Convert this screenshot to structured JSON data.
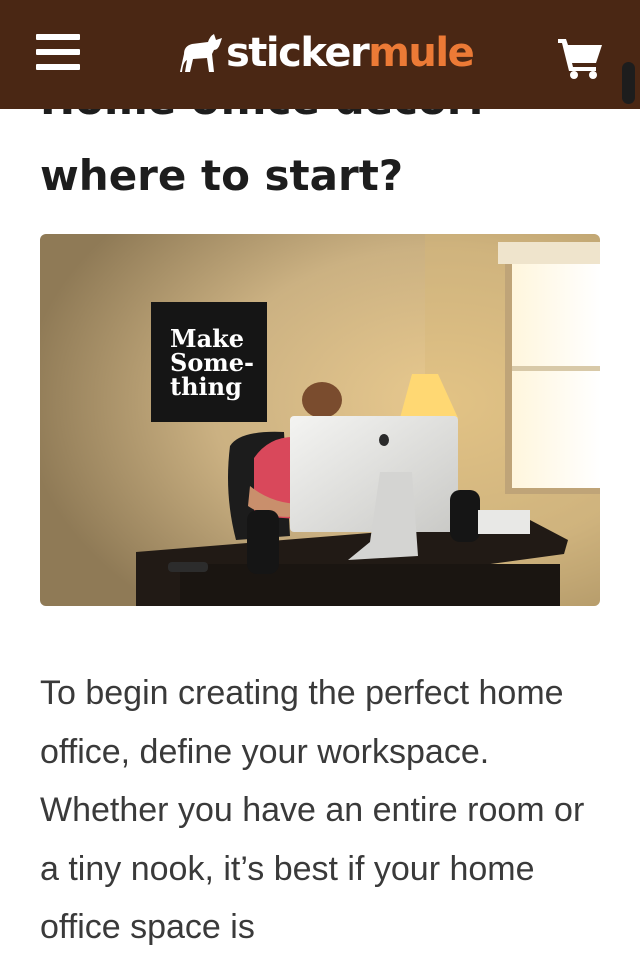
{
  "header": {
    "brand_part1": "sticker",
    "brand_part2": "mule",
    "menu_icon": "hamburger-menu-icon",
    "cart_icon": "shopping-cart-icon",
    "colors": {
      "bar": "#4a2714",
      "accent": "#ec7a36"
    }
  },
  "article": {
    "title_line1": "Home office decor:",
    "title_line2": "where to start?",
    "poster_line1": "Make",
    "poster_line2": "Some-",
    "poster_line3": "thing",
    "paragraph": "To begin creating the perfect home office, define your workspace. Whether you have an entire room or a tiny nook, it’s best if your home office space is"
  }
}
